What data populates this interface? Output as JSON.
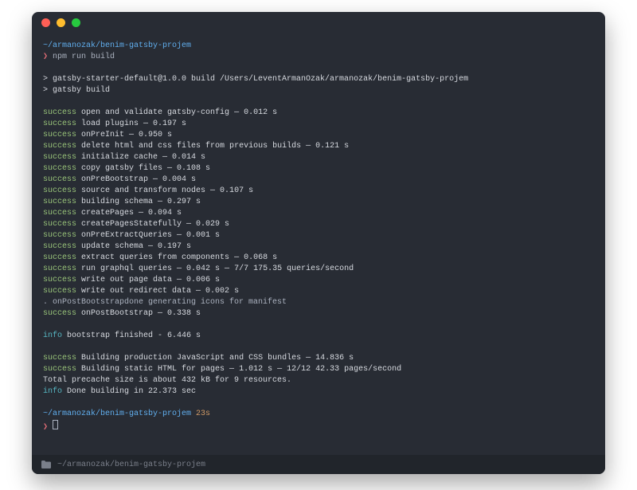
{
  "window": {
    "traffic_lights": [
      "red",
      "yellow",
      "green"
    ]
  },
  "session": {
    "cwd": "~/armanozak/benim-gatsby-projem",
    "prompt_char": "❯",
    "command": "npm run build",
    "elapsed": "23s"
  },
  "output": {
    "banner1": "> gatsby-starter-default@1.0.0 build /Users/LeventArmanOzak/armanozak/benim-gatsby-projem",
    "banner2": "> gatsby build",
    "steps": [
      "open and validate gatsby-config — 0.012 s",
      "load plugins — 0.197 s",
      "onPreInit — 0.950 s",
      "delete html and css files from previous builds — 0.121 s",
      "initialize cache — 0.014 s",
      "copy gatsby files — 0.108 s",
      "onPreBootstrap — 0.004 s",
      "source and transform nodes — 0.107 s",
      "building schema — 0.297 s",
      "createPages — 0.094 s",
      "createPagesStatefully — 0.029 s",
      "onPreExtractQueries — 0.001 s",
      "update schema — 0.197 s",
      "extract queries from components — 0.068 s",
      "run graphql queries — 0.042 s — 7/7 175.35 queries/second",
      "write out page data — 0.006 s",
      "write out redirect data — 0.002 s"
    ],
    "dot_line": ". onPostBootstrapdone generating icons for manifest",
    "post_bootstrap": "onPostBootstrap — 0.338 s",
    "info_bootstrap": "bootstrap finished - 6.446 s",
    "build_js": "Building production JavaScript and CSS bundles — 14.836 s",
    "build_html": "Building static HTML for pages — 1.012 s — 12/12 42.33 pages/second",
    "precache": "Total precache size is about 432 kB for 9 resources.",
    "info_done": "Done building in 22.373 sec"
  },
  "labels": {
    "success": "success",
    "info": "info"
  },
  "statusbar": {
    "path": "~/armanozak/benim-gatsby-projem"
  }
}
